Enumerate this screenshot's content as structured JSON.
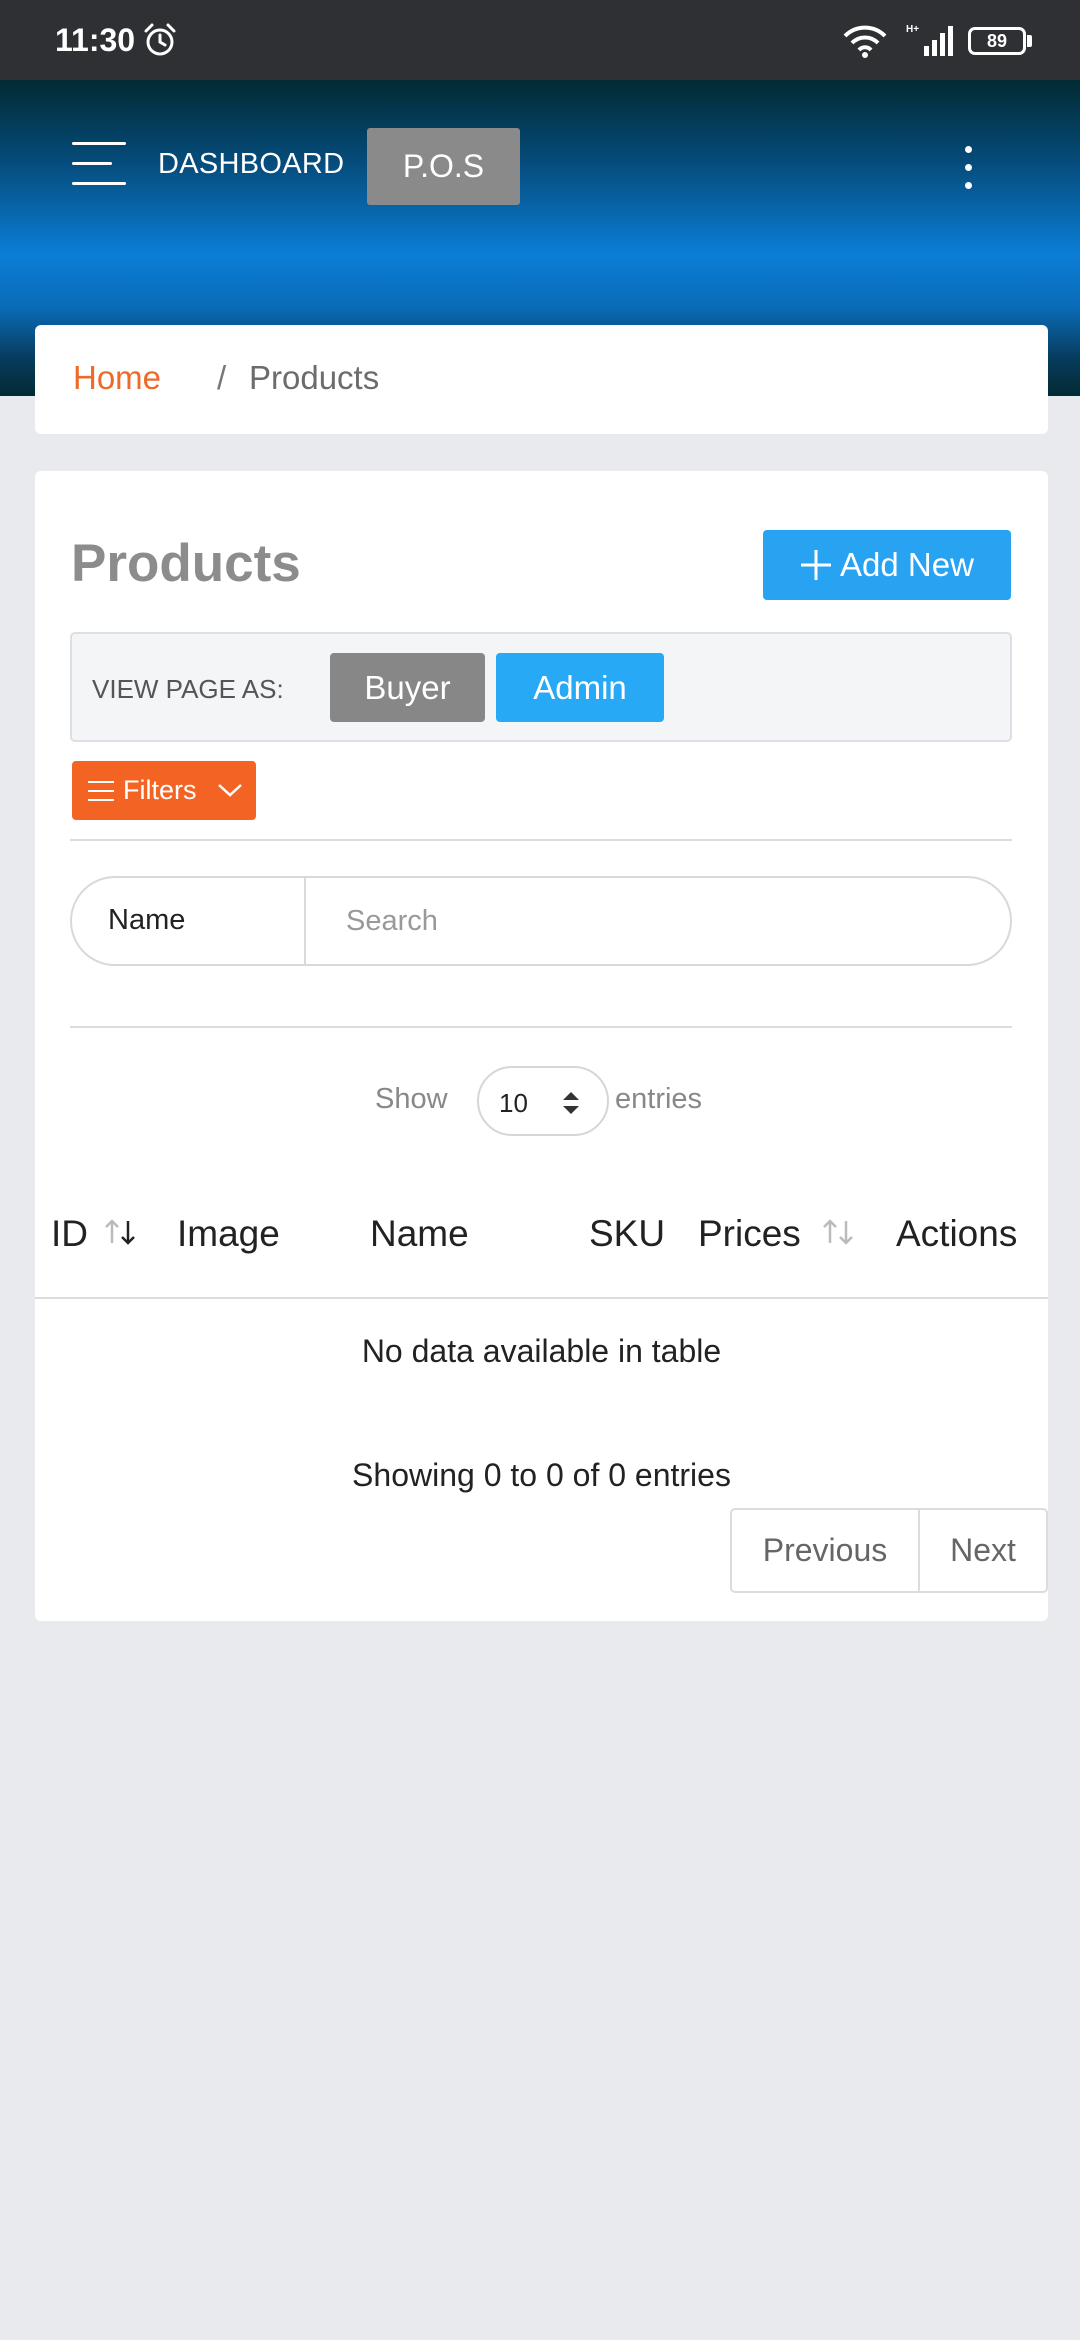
{
  "status_bar": {
    "time": "11:30",
    "battery": "89"
  },
  "header": {
    "dashboard_label": "DASHBOARD",
    "pos_label": "P.O.S"
  },
  "breadcrumb": {
    "home": "Home",
    "separator": "/",
    "current": "Products"
  },
  "page": {
    "title": "Products",
    "add_new_label": "Add New",
    "view_as_label": "VIEW PAGE AS:",
    "view_as_options": [
      "Buyer",
      "Admin"
    ],
    "view_as_selected": "Admin",
    "filters_label": "Filters"
  },
  "search": {
    "field_label": "Name",
    "placeholder": "Search"
  },
  "length_menu": {
    "show_label": "Show",
    "value": "10",
    "entries_label": "entries"
  },
  "table": {
    "columns": [
      "ID",
      "Image",
      "Name",
      "SKU",
      "Prices",
      "Actions"
    ],
    "rows": [],
    "empty_message": "No data available in table",
    "info": "Showing 0 to 0 of 0 entries"
  },
  "pagination": {
    "previous": "Previous",
    "next": "Next"
  },
  "colors": {
    "accent_orange": "#f36424",
    "accent_blue": "#27a3f2",
    "header_blue": "#0a7ed6",
    "button_gray": "#878787"
  },
  "icons": [
    "alarm-icon",
    "wifi-icon",
    "signal-icon",
    "battery-icon",
    "menu-icon",
    "more-vertical-icon",
    "plus-icon",
    "filter-lines-icon",
    "chevron-down-icon",
    "sort-icon",
    "select-arrows-icon"
  ]
}
